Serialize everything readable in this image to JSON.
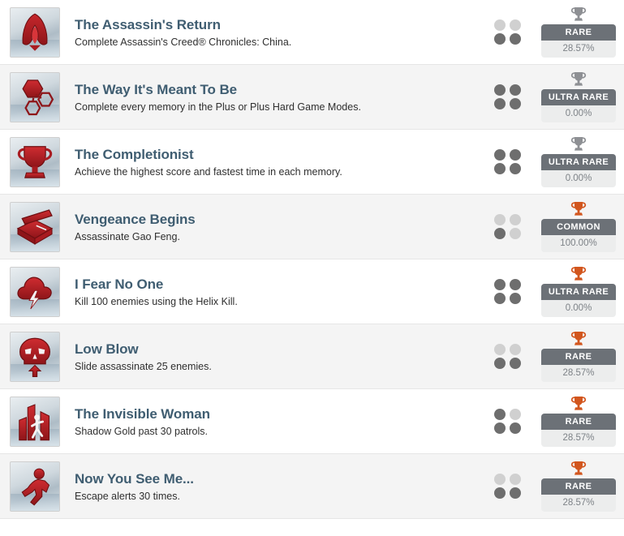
{
  "colors": {
    "title": "#3f5d71",
    "badge_bg": "#6c7177",
    "pct_bg": "#eceded",
    "trophy_silver": "#8e9094",
    "trophy_bronze": "#d2561e",
    "dot_on": "#6e6e6e",
    "dot_off": "#d0d0d0",
    "row_bg": "#ffffff",
    "row_bg_alt": "#f4f4f4"
  },
  "achievements": [
    {
      "title": "The Assassin's Return",
      "description": "Complete Assassin's Creed® Chronicles: China.",
      "icon": "assassin-hood-icon",
      "trophy": "trophy-icon",
      "trophy_tier": "silver",
      "rarity": "RARE",
      "percent": "28.57%",
      "dots": [
        false,
        false,
        true,
        true
      ]
    },
    {
      "title": "The Way It's Meant To Be",
      "description": "Complete every memory in the Plus or Plus Hard Game Modes.",
      "icon": "hexagon-cluster-icon",
      "trophy": "trophy-icon",
      "trophy_tier": "silver",
      "rarity": "ULTRA RARE",
      "percent": "0.00%",
      "dots": [
        true,
        true,
        true,
        true
      ]
    },
    {
      "title": "The Completionist",
      "description": "Achieve the highest score and fastest time in each memory.",
      "icon": "trophy-cup-icon",
      "trophy": "trophy-icon",
      "trophy_tier": "silver",
      "rarity": "ULTRA RARE",
      "percent": "0.00%",
      "dots": [
        true,
        true,
        true,
        true
      ]
    },
    {
      "title": "Vengeance Begins",
      "description": "Assassinate Gao Feng.",
      "icon": "slashed-crate-icon",
      "trophy": "trophy-icon",
      "trophy_tier": "bronze",
      "rarity": "COMMON",
      "percent": "100.00%",
      "dots": [
        false,
        false,
        true,
        false
      ]
    },
    {
      "title": "I Fear No One",
      "description": "Kill 100 enemies using the Helix Kill.",
      "icon": "storm-cloud-icon",
      "trophy": "trophy-icon",
      "trophy_tier": "bronze",
      "rarity": "ULTRA RARE",
      "percent": "0.00%",
      "dots": [
        true,
        true,
        true,
        true
      ]
    },
    {
      "title": "Low Blow",
      "description": "Slide assassinate 25 enemies.",
      "icon": "skull-arrow-icon",
      "trophy": "trophy-icon",
      "trophy_tier": "bronze",
      "rarity": "RARE",
      "percent": "28.57%",
      "dots": [
        false,
        false,
        true,
        true
      ]
    },
    {
      "title": "The Invisible Woman",
      "description": "Shadow Gold past 30 patrols.",
      "icon": "city-runner-icon",
      "trophy": "trophy-icon",
      "trophy_tier": "bronze",
      "rarity": "RARE",
      "percent": "28.57%",
      "dots": [
        true,
        false,
        true,
        true
      ]
    },
    {
      "title": "Now You See Me...",
      "description": "Escape alerts 30 times.",
      "icon": "running-figure-icon",
      "trophy": "trophy-icon",
      "trophy_tier": "bronze",
      "rarity": "RARE",
      "percent": "28.57%",
      "dots": [
        false,
        false,
        true,
        true
      ]
    }
  ]
}
